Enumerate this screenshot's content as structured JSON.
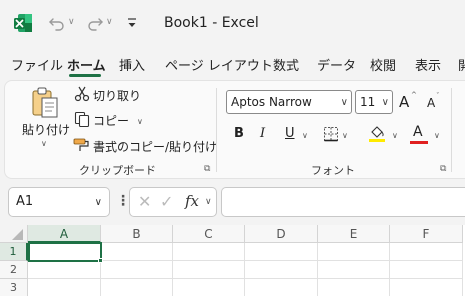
{
  "app": {
    "title": "Book1  -  Excel",
    "undo_icon": "undo-icon",
    "redo_icon": "redo-icon",
    "customize_icon": "customize-qat-icon"
  },
  "tabs": [
    {
      "label": "ファイル"
    },
    {
      "label": "ホーム"
    },
    {
      "label": "挿入"
    },
    {
      "label": "ページ レイアウト"
    },
    {
      "label": "数式"
    },
    {
      "label": "データ"
    },
    {
      "label": "校閲"
    },
    {
      "label": "表示"
    },
    {
      "label": "開"
    }
  ],
  "clipboard": {
    "paste_label": "貼り付け",
    "cut_label": "切り取り",
    "copy_label": "コピー",
    "format_painter_label": "書式のコピー/貼り付け",
    "group_label": "クリップボード"
  },
  "font": {
    "family": "Aptos Narrow",
    "size": "11",
    "grow_label": "A",
    "shrink_label": "A",
    "bold_label": "B",
    "italic_label": "I",
    "underline_label": "U",
    "font_color_label": "A",
    "group_label": "フォント",
    "fill_color": "#ffeb00",
    "font_color": "#e02020"
  },
  "formula_bar": {
    "name_box": "A1",
    "fx_label": "fx",
    "formula": ""
  },
  "grid": {
    "columns": [
      "A",
      "B",
      "C",
      "D",
      "E",
      "F"
    ],
    "rows": [
      "1",
      "2",
      "3"
    ],
    "selected_cell": "A1"
  },
  "colors": {
    "accent": "#1e7145"
  }
}
